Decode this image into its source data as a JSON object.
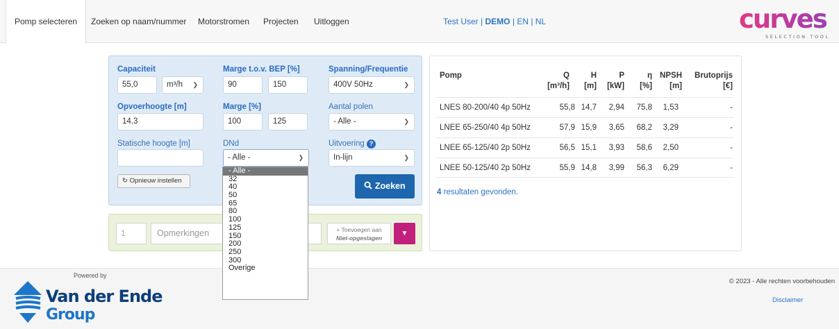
{
  "nav": {
    "items": [
      "Pomp selecteren",
      "Zoeken op naam/nummer",
      "Motorstromen",
      "Projecten",
      "Uitloggen"
    ],
    "user": "Test User",
    "demo": "DEMO",
    "lang_en": "EN",
    "lang_nl": "NL",
    "sep": "|",
    "logo_text": "curves",
    "logo_tagline": "SELECTION TOOL"
  },
  "form": {
    "capaciteit_label": "Capaciteit",
    "capaciteit_value": "55,0",
    "capaciteit_unit": "m³/h",
    "marge_bep_label": "Marge t.o.v. BEP [%]",
    "marge_bep_min": "90",
    "marge_bep_max": "150",
    "spanning_label": "Spanning/Frequentie",
    "spanning_value": "400V 50Hz",
    "opvoerhoogte_label": "Opvoerhoogte [m]",
    "opvoerhoogte_value": "14,3",
    "marge_label": "Marge [%]",
    "marge_min": "100",
    "marge_max": "125",
    "polen_label": "Aantal polen",
    "polen_value": "- Alle -",
    "statische_label": "Statische hoogte [m]",
    "statische_value": "",
    "dnd_label": "DNd",
    "dnd_value": "- Alle -",
    "uitvoering_label": "Uitvoering",
    "uitvoering_value": "In-lijn",
    "reset_label": "Opnieuw instellen",
    "search_label": "Zoeken"
  },
  "dnd_options": [
    "- Alle -",
    "32",
    "40",
    "50",
    "65",
    "80",
    "100",
    "125",
    "150",
    "200",
    "250",
    "300",
    "Overige"
  ],
  "notes": {
    "qty_placeholder": "1",
    "remarks_placeholder": "Opmerkingen",
    "add_label": "+ Toevoegen aan",
    "add_target": "Niet-opgeslagen"
  },
  "results": {
    "headers": {
      "pomp": "Pomp",
      "q": "Q",
      "q_unit": "[m³/h]",
      "h": "H",
      "h_unit": "[m]",
      "p": "P",
      "p_unit": "[kW]",
      "eta": "η",
      "eta_unit": "[%]",
      "npsh": "NPSH",
      "npsh_unit": "[m]",
      "bruto": "Brutoprijs",
      "bruto_unit": "[€]"
    },
    "rows": [
      {
        "name": "LNES 80-200/40 4p 50Hz",
        "q": "55,8",
        "h": "14,7",
        "p": "2,94",
        "eta": "75,8",
        "npsh": "1,53",
        "price": "-"
      },
      {
        "name": "LNEE 65-250/40 4p 50Hz",
        "q": "57,9",
        "h": "15,9",
        "p": "3,65",
        "eta": "68,2",
        "npsh": "3,29",
        "price": "-"
      },
      {
        "name": "LNEE 65-125/40 2p 50Hz",
        "q": "56,5",
        "h": "15,1",
        "p": "3,93",
        "eta": "58,6",
        "npsh": "2,50",
        "price": "-"
      },
      {
        "name": "LNEE 50-125/40 2p 50Hz",
        "q": "55,9",
        "h": "14,8",
        "p": "3,99",
        "eta": "56,3",
        "npsh": "6,29",
        "price": "-"
      }
    ],
    "found_count": "4",
    "found_text": "resultaten gevonden."
  },
  "footer": {
    "powered_by": "Powered by",
    "company_line1": "Van der Ende",
    "company_line2": "Group",
    "copyright": "© 2023 - Alle rechten voorbehouden",
    "disclaimer": "Disclaimer"
  },
  "colors": {
    "accent_blue": "#1e66ad",
    "link_blue": "#2a73c4",
    "magenta": "#c2207c",
    "form_bg": "#deebf7",
    "notes_bg": "#eaf2dc"
  },
  "icons": [
    "refresh-icon",
    "search-icon",
    "help-icon",
    "chevron-down-icon",
    "caret-down-icon"
  ]
}
